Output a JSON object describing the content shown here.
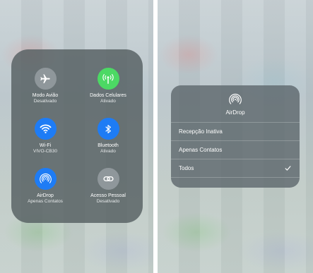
{
  "left_panel": {
    "buttons": [
      {
        "title": "Modo Avião",
        "status": "Desativado",
        "icon": "airplane-icon",
        "color": "#969ea2"
      },
      {
        "title": "Dados Celulares",
        "status": "Ativado",
        "icon": "cellular-antenna-icon",
        "color": "#4cd964"
      },
      {
        "title": "Wi-Fi",
        "status": "VIVO-CB30",
        "icon": "wifi-icon",
        "color": "#1e7cf5"
      },
      {
        "title": "Bluetooth",
        "status": "Ativado",
        "icon": "bluetooth-icon",
        "color": "#1e7cf5"
      },
      {
        "title": "AirDrop",
        "status": "Apenas Contatos",
        "icon": "airdrop-icon",
        "color": "#1e7cf5"
      },
      {
        "title": "Acesso Pessoal",
        "status": "Desativado",
        "icon": "personal-hotspot-icon",
        "color": "#969ea2"
      }
    ]
  },
  "right_panel": {
    "title": "AirDrop",
    "header_icon": "airdrop-icon",
    "options": [
      {
        "label": "Recepção Inativa",
        "selected": false
      },
      {
        "label": "Apenas Contatos",
        "selected": false
      },
      {
        "label": "Todos",
        "selected": true
      }
    ],
    "check_icon": "checkmark-icon"
  }
}
